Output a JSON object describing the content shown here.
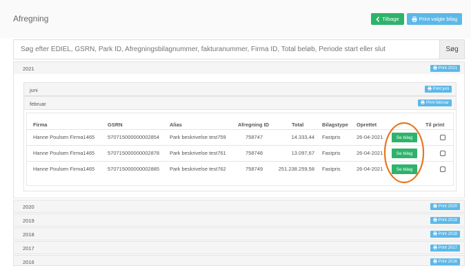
{
  "header": {
    "title": "Afregning",
    "back_label": "Tilbage",
    "print_selected_label": "Print valgte bilag"
  },
  "search": {
    "placeholder": "Søg efter EDIEL, GSRN, Park ID, Afregningsbilagnummer, fakturanummer, Firma ID, Total beløb, Periode start eller slut",
    "value": "",
    "button_label": "Søg"
  },
  "years": [
    {
      "label": "2021",
      "print_label": "Print 2021"
    },
    {
      "label": "2020",
      "print_label": "Print 2020"
    },
    {
      "label": "2019",
      "print_label": "Print 2019"
    },
    {
      "label": "2018",
      "print_label": "Print 2018"
    },
    {
      "label": "2017",
      "print_label": "Print 2017"
    },
    {
      "label": "2016",
      "print_label": "Print 2016"
    }
  ],
  "months": [
    {
      "label": "juni",
      "print_label": "Print juni"
    },
    {
      "label": "februar",
      "print_label": "Print februar"
    }
  ],
  "table": {
    "columns": [
      "Firma",
      "GSRN",
      "Alias",
      "Afregning ID",
      "Total",
      "Bilagstype",
      "Oprettet",
      "",
      "Til print"
    ],
    "rows": [
      {
        "firma": "Hanne Poulsen Firma1465",
        "gsrn": "570715000000002854",
        "alias": "Park beskrivelse test759",
        "afregning_id": "758747",
        "total": "14.333,44",
        "bilagstype": "Fastpris",
        "oprettet": "26-04-2021",
        "action": "Se bilag",
        "checked": false
      },
      {
        "firma": "Hanne Poulsen Firma1465",
        "gsrn": "570715000000002878",
        "alias": "Park beskrivelse test761",
        "afregning_id": "758748",
        "total": "13.097,67",
        "bilagstype": "Fastpris",
        "oprettet": "26-04-2021",
        "action": "Se bilag",
        "checked": false
      },
      {
        "firma": "Hanne Poulsen Firma1465",
        "gsrn": "570715000000002885",
        "alias": "Park beskrivelse test762",
        "afregning_id": "758749",
        "total": "251.238.259,58",
        "bilagstype": "Fastpris",
        "oprettet": "26-04-2021",
        "action": "Se bilag",
        "checked": false
      }
    ]
  },
  "colors": {
    "green": "#2db36b",
    "blue": "#5cb8e8",
    "highlight_oval": "#e8761e"
  },
  "icons": {
    "back": "chevron-left-icon",
    "print": "printer-icon"
  }
}
